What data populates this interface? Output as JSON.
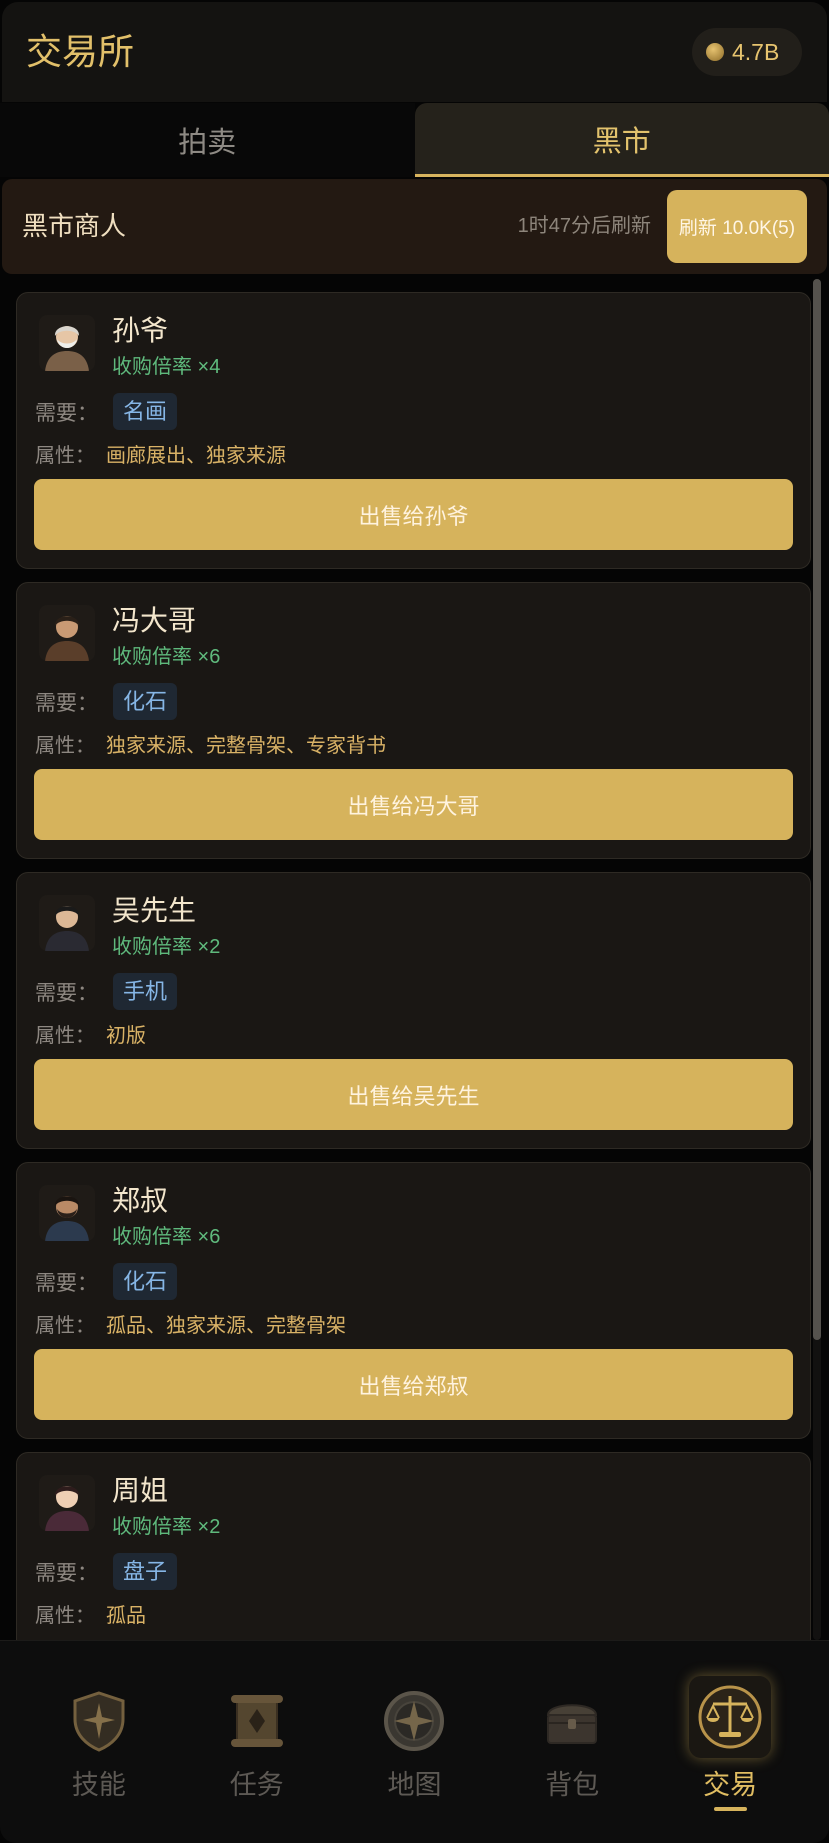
{
  "header": {
    "title": "交易所",
    "coins": "4.7B",
    "coin_icon": "coin-icon"
  },
  "tabs": [
    {
      "label": "拍卖",
      "active": false
    },
    {
      "label": "黑市",
      "active": true
    }
  ],
  "merchant_bar": {
    "title": "黑市商人",
    "refresh_timer": "1时47分后刷新",
    "refresh_button": "刷新 10.0K(5)"
  },
  "labels": {
    "need": "需要：",
    "attributes": "属性："
  },
  "buyers": [
    {
      "name": "孙爷",
      "rate": "收购倍率 ×4",
      "need": "名画",
      "attributes": "画廊展出、独家来源",
      "sell_label": "出售给孙爷"
    },
    {
      "name": "冯大哥",
      "rate": "收购倍率 ×6",
      "need": "化石",
      "attributes": "独家来源、完整骨架、专家背书",
      "sell_label": "出售给冯大哥"
    },
    {
      "name": "吴先生",
      "rate": "收购倍率 ×2",
      "need": "手机",
      "attributes": "初版",
      "sell_label": "出售给吴先生"
    },
    {
      "name": "郑叔",
      "rate": "收购倍率 ×6",
      "need": "化石",
      "attributes": "孤品、独家来源、完整骨架",
      "sell_label": "出售给郑叔"
    },
    {
      "name": "周姐",
      "rate": "收购倍率 ×2",
      "need": "盘子",
      "attributes": "孤品"
    }
  ],
  "bottom_nav": [
    {
      "label": "技能",
      "icon": "shield-icon",
      "active": false
    },
    {
      "label": "任务",
      "icon": "scroll-icon",
      "active": false
    },
    {
      "label": "地图",
      "icon": "compass-icon",
      "active": false
    },
    {
      "label": "背包",
      "icon": "chest-icon",
      "active": false
    },
    {
      "label": "交易",
      "icon": "scales-icon",
      "active": true
    }
  ],
  "colors": {
    "gold": "#d6b35c",
    "green": "#5fba7d",
    "tag_text": "#86b6e6"
  }
}
